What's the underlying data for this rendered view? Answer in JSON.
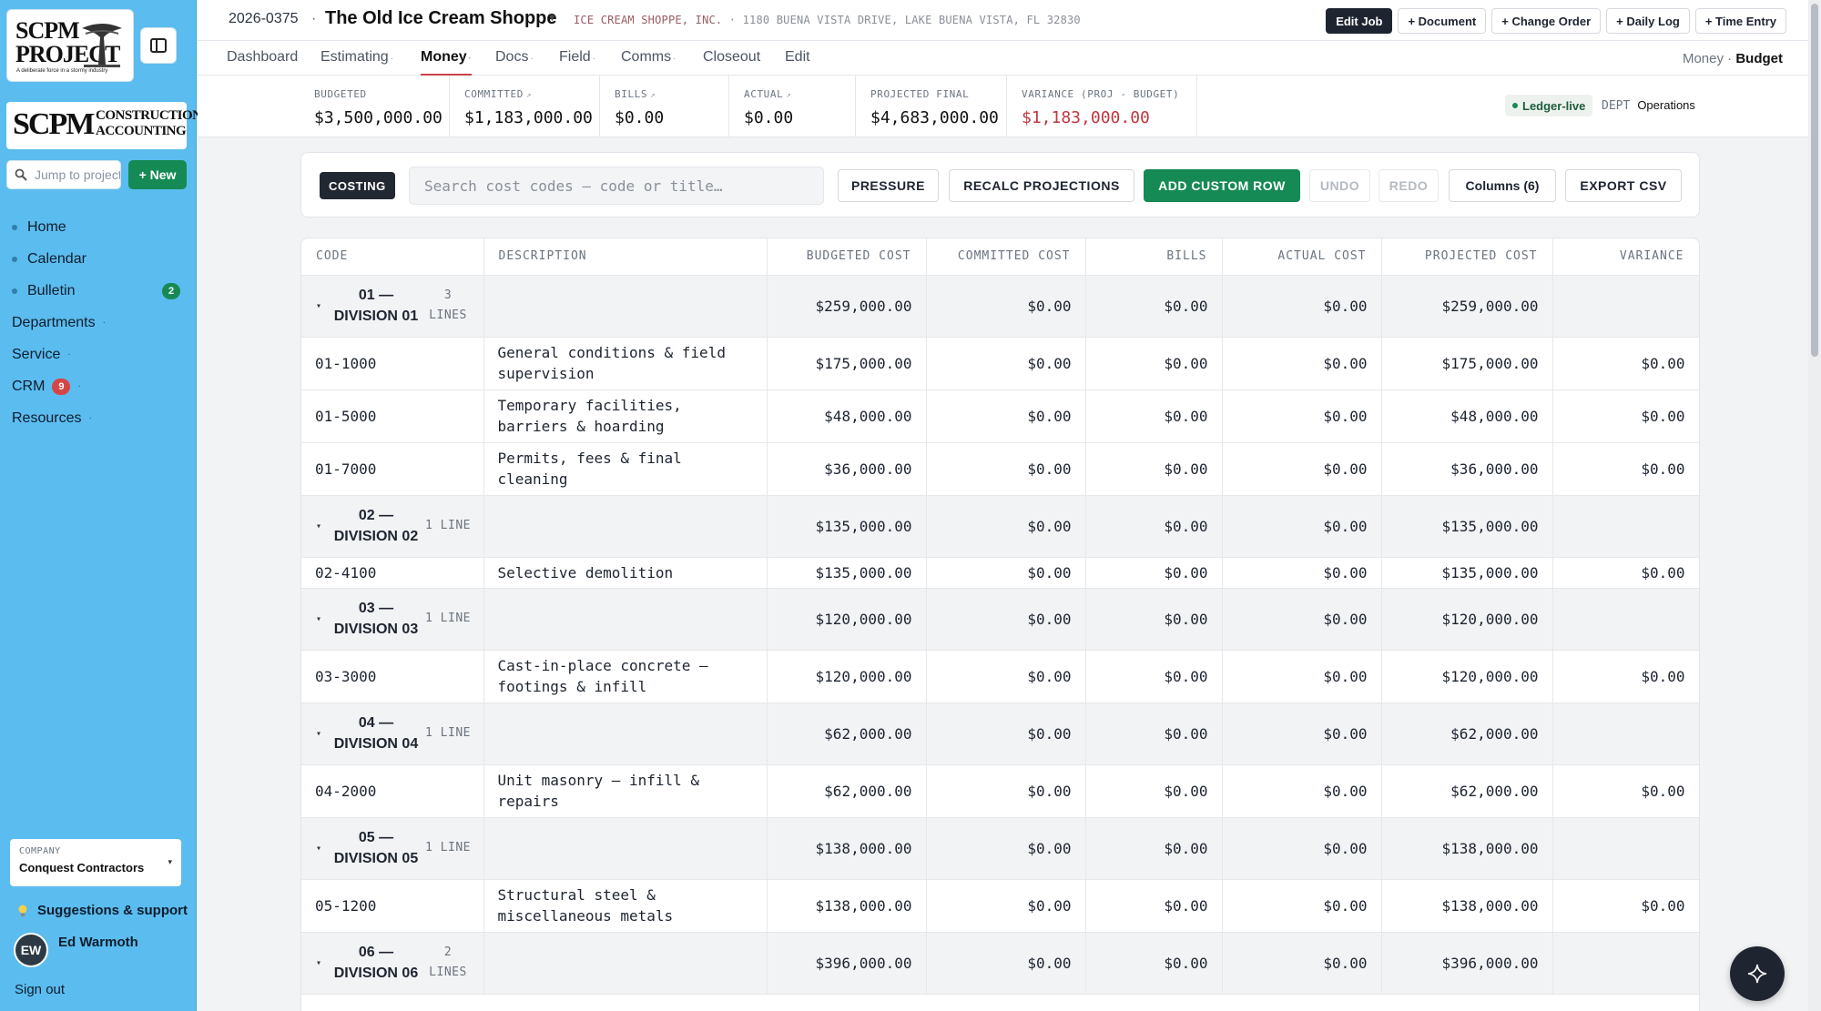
{
  "sidebar": {
    "logo_project": {
      "line1": "SCPM",
      "line2": "PROJECT",
      "tagline": "A deliberate force in a stormy industry"
    },
    "logo_accounting": {
      "big": "SCPM",
      "line1": "CONSTRUCTION",
      "line2": "ACCOUNTING"
    },
    "jump_placeholder": "Jump to project",
    "new_label": "+ New",
    "nav": [
      {
        "label": "Home"
      },
      {
        "label": "Calendar"
      },
      {
        "label": "Bulletin",
        "badge": "2"
      }
    ],
    "groups": [
      {
        "label": "Departments"
      },
      {
        "label": "Service"
      },
      {
        "label": "CRM",
        "badge": "9"
      },
      {
        "label": "Resources"
      }
    ],
    "company_label": "COMPANY",
    "company_value": "Conquest Contractors",
    "suggestions": "Suggestions & support",
    "user_initials": "EW",
    "user_name": "Ed Warmoth",
    "signout": "Sign out"
  },
  "header": {
    "job_number": "2026-0375",
    "separator": "·",
    "job_title": "The Old Ice Cream Shoppe",
    "client": "ICE CREAM SHOPPE, INC.",
    "address": "· 1180 BUENA VISTA DRIVE, LAKE BUENA VISTA, FL 32830",
    "buttons": [
      "Edit Job",
      "+ Document",
      "+ Change Order",
      "+ Daily Log",
      "+ Time Entry"
    ]
  },
  "tabs": [
    {
      "label": "Dashboard",
      "caret": ""
    },
    {
      "label": "Estimating",
      "caret": "·"
    },
    {
      "label": "Money",
      "caret": "·"
    },
    {
      "label": "Docs",
      "caret": "·"
    },
    {
      "label": "Field",
      "caret": "·"
    },
    {
      "label": "Comms",
      "caret": "·"
    },
    {
      "label": "Closeout",
      "caret": ""
    },
    {
      "label": "Edit",
      "caret": ""
    }
  ],
  "breadcrumb": {
    "parent": "Money",
    "sep": "·",
    "current": "Budget"
  },
  "summary": [
    {
      "label": "BUDGETED",
      "arrow": "",
      "value": "$3,500,000.00"
    },
    {
      "label": "COMMITTED",
      "arrow": "↗",
      "value": "$1,183,000.00"
    },
    {
      "label": "BILLS",
      "arrow": "↗",
      "value": "$0.00"
    },
    {
      "label": "ACTUAL",
      "arrow": "↗",
      "value": "$0.00"
    },
    {
      "label": "PROJECTED FINAL",
      "arrow": "",
      "value": "$4,683,000.00"
    },
    {
      "label": "VARIANCE (PROJ - BUDGET)",
      "arrow": "",
      "value": "$1,183,000.00"
    }
  ],
  "ledger_label": "Ledger-live",
  "dept_label": "DEPT",
  "dept_value": "Operations",
  "toolbar": {
    "mode": "COSTING",
    "search_placeholder": "Search cost codes — code or title…",
    "pressure": "PRESSURE",
    "recalc": "RECALC PROJECTIONS",
    "add_row": "ADD CUSTOM ROW",
    "undo": "UNDO",
    "redo": "REDO",
    "columns": "Columns (6)",
    "export": "EXPORT CSV"
  },
  "table": {
    "headers": [
      "CODE",
      "DESCRIPTION",
      "BUDGETED COST",
      "COMMITTED COST",
      "BILLS",
      "ACTUAL COST",
      "PROJECTED COST",
      "VARIANCE"
    ],
    "rows": [
      {
        "type": "group",
        "code": "01 — DIVISION 01",
        "lines": "3 LINES",
        "budgeted": "$259,000.00",
        "committed": "$0.00",
        "bills": "$0.00",
        "actual": "$0.00",
        "projected": "$259,000.00",
        "variance": ""
      },
      {
        "type": "line",
        "code": "01-1000",
        "desc": "General conditions & field supervision",
        "budgeted": "$175,000.00",
        "committed": "$0.00",
        "bills": "$0.00",
        "actual": "$0.00",
        "projected": "$175,000.00",
        "variance": "$0.00"
      },
      {
        "type": "line",
        "code": "01-5000",
        "desc": "Temporary facilities, barriers & hoarding",
        "budgeted": "$48,000.00",
        "committed": "$0.00",
        "bills": "$0.00",
        "actual": "$0.00",
        "projected": "$48,000.00",
        "variance": "$0.00"
      },
      {
        "type": "line",
        "code": "01-7000",
        "desc": "Permits, fees & final cleaning",
        "budgeted": "$36,000.00",
        "committed": "$0.00",
        "bills": "$0.00",
        "actual": "$0.00",
        "projected": "$36,000.00",
        "variance": "$0.00"
      },
      {
        "type": "group",
        "code": "02 — DIVISION 02",
        "lines": "1 LINE",
        "budgeted": "$135,000.00",
        "committed": "$0.00",
        "bills": "$0.00",
        "actual": "$0.00",
        "projected": "$135,000.00",
        "variance": ""
      },
      {
        "type": "line",
        "code": "02-4100",
        "desc": "Selective demolition",
        "budgeted": "$135,000.00",
        "committed": "$0.00",
        "bills": "$0.00",
        "actual": "$0.00",
        "projected": "$135,000.00",
        "variance": "$0.00"
      },
      {
        "type": "group",
        "code": "03 — DIVISION 03",
        "lines": "1 LINE",
        "budgeted": "$120,000.00",
        "committed": "$0.00",
        "bills": "$0.00",
        "actual": "$0.00",
        "projected": "$120,000.00",
        "variance": ""
      },
      {
        "type": "line",
        "code": "03-3000",
        "desc": "Cast-in-place concrete — footings & infill",
        "budgeted": "$120,000.00",
        "committed": "$0.00",
        "bills": "$0.00",
        "actual": "$0.00",
        "projected": "$120,000.00",
        "variance": "$0.00"
      },
      {
        "type": "group",
        "code": "04 — DIVISION 04",
        "lines": "1 LINE",
        "budgeted": "$62,000.00",
        "committed": "$0.00",
        "bills": "$0.00",
        "actual": "$0.00",
        "projected": "$62,000.00",
        "variance": ""
      },
      {
        "type": "line",
        "code": "04-2000",
        "desc": "Unit masonry — infill & repairs",
        "budgeted": "$62,000.00",
        "committed": "$0.00",
        "bills": "$0.00",
        "actual": "$0.00",
        "projected": "$62,000.00",
        "variance": "$0.00"
      },
      {
        "type": "group",
        "code": "05 — DIVISION 05",
        "lines": "1 LINE",
        "budgeted": "$138,000.00",
        "committed": "$0.00",
        "bills": "$0.00",
        "actual": "$0.00",
        "projected": "$138,000.00",
        "variance": ""
      },
      {
        "type": "line",
        "code": "05-1200",
        "desc": "Structural steel & miscellaneous metals",
        "budgeted": "$138,000.00",
        "committed": "$0.00",
        "bills": "$0.00",
        "actual": "$0.00",
        "projected": "$138,000.00",
        "variance": "$0.00"
      },
      {
        "type": "group",
        "code": "06 — DIVISION 06",
        "lines": "2 LINES",
        "budgeted": "$396,000.00",
        "committed": "$0.00",
        "bills": "$0.00",
        "actual": "$0.00",
        "projected": "$396,000.00",
        "variance": ""
      }
    ]
  },
  "colors": {
    "sidebar": "#5bbcef",
    "accent_green": "#168a55",
    "variance_red": "#c0373f",
    "badge_red": "#d64545",
    "tab_underline": "#c9404a"
  },
  "icons": {
    "sidebar_toggle": "sidebar-toggle-icon",
    "search": "search-icon",
    "bulb": "lightbulb-icon",
    "assistant": "sparkle-icon",
    "group_toggle": "caret-down-icon"
  }
}
